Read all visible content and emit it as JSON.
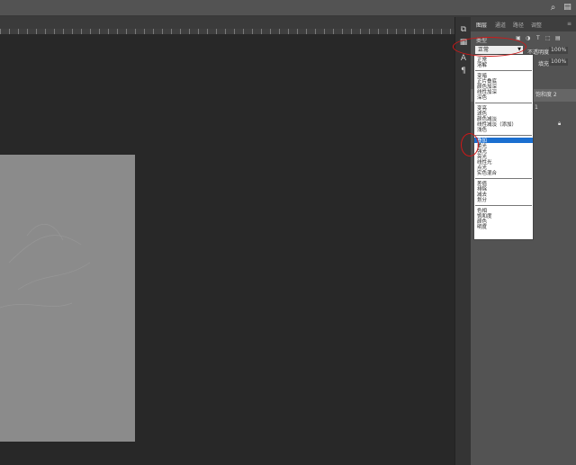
{
  "layers_panel": {
    "tabs": [
      "图层",
      "通道",
      "路径",
      "调整"
    ],
    "kind_filter": "类型",
    "blend_mode": "正常",
    "opacity_label": "不透明度:",
    "opacity_value": "100%",
    "fill_label": "填充:",
    "fill_value": "100%",
    "layer_name": "饱和度 2",
    "layer_index": "1"
  },
  "blend_dropdown": {
    "groups": [
      [
        "正常",
        "溶解"
      ],
      [
        "变暗",
        "正片叠底",
        "颜色加深",
        "线性加深",
        "深色"
      ],
      [
        "变亮",
        "滤色",
        "颜色减淡",
        "线性减淡（添加）",
        "浅色"
      ],
      [
        "叠加",
        "柔光",
        "强光",
        "亮光",
        "线性光",
        "点光",
        "实色混合"
      ],
      [
        "差值",
        "排除",
        "减去",
        "划分"
      ],
      [
        "色相",
        "饱和度",
        "颜色",
        "明度"
      ]
    ],
    "selected": "叠加"
  },
  "icons": {
    "search": "search-icon",
    "workspace": "workspace-icon"
  },
  "colors": {
    "highlight": "#1b6fd0",
    "annotation_ring": "#d01818",
    "panel_bg": "#535353"
  }
}
